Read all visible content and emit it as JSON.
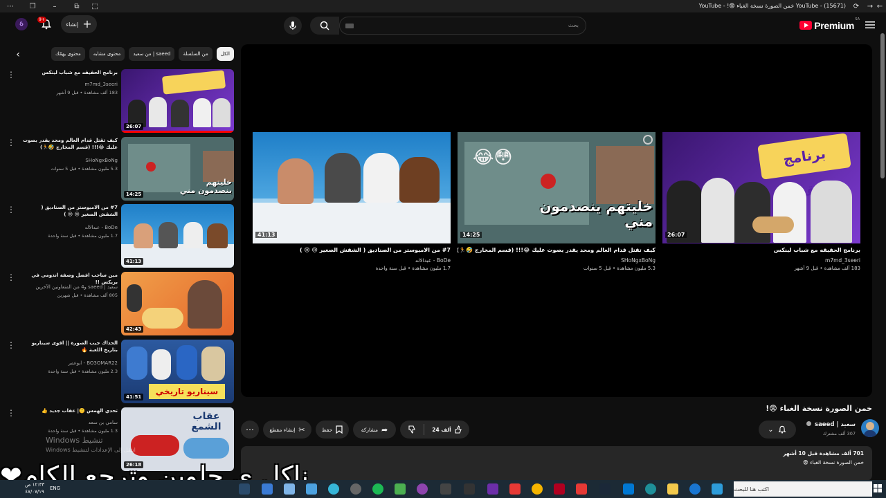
{
  "browser": {
    "window_title": "YouTube - (15671) خمن الصورة نسخة الغباء 😨! - YouTube"
  },
  "header": {
    "search_placeholder": "بحث",
    "create_label": "إنشاء",
    "logo_word": "Premium",
    "logo_region": "SA",
    "notification_count": "9+"
  },
  "chips": [
    "الكل",
    "من السلسلة",
    "من سعيد | saeed",
    "محتوى مشابه",
    "محتوى يهمّك"
  ],
  "recommendations": [
    {
      "title": "برنامج الحقيقه مع شباب لينكس",
      "channel": "m7md_3seeri",
      "meta": "183 ألف مشاهدة • قبل 9 أشهر",
      "duration": "26:07"
    },
    {
      "title": "كيف تقتل قدام العالم ومحد يقدر يصوت عليك 😂!!! (قسم المخارج 🤣🏃)",
      "channel": "SHoNgxBoNg",
      "meta": "5.3 مليون مشاهدة • قبل 5 سنوات",
      "duration": "14:25"
    },
    {
      "title": "#7 من الاميوستر من الصناديق ( الشقش الصغير 😢 😢 )",
      "channel": "BoDe - عبدالاله",
      "meta": "1.7 مليون مشاهدة • قبل سنة واحدة",
      "duration": "41:13"
    },
    {
      "title": "مين ساحب افضل وصفة اندومي في بريكس !!",
      "channel": "سعيد | saeed و4 من المتعاونين الآخرين",
      "meta": "805 آلف مشاهدة • قبل شهرين",
      "duration": "42:43"
    },
    {
      "title": "الحداك جيب الصورة || اقوى سيناريو بتاريخ اللعبة 🔥",
      "channel": "BO3OMAR22 - ابوعمر",
      "meta": "2.3 مليون مشاهدة • قبل سنة واحدة",
      "duration": "41:51"
    },
    {
      "title": "تحدي الهمس 🤫| عقاب جديد 👍",
      "channel": "سامي بن سعد",
      "meta": "1.3 مليون مشاهدة • قبل سنة واحدة",
      "duration": "26:18"
    }
  ],
  "endcards": [
    {
      "title": "برنامج الحقيقه مع شباب لينكس",
      "channel": "m7md_3seeri",
      "meta": "183 ألف مشاهدة • قبل 9 أشهر",
      "duration": "26:07",
      "thumb_text": "برنامج الحقيقة"
    },
    {
      "title": "كيف تقتل قدام العالم ومحد يقدر يصوت عليك 😂!!! (قسم المخارج 🤣🏃)",
      "channel": "SHoNgxBoNg",
      "meta": "5.3 مليون مشاهدة • قبل 5 سنوات",
      "duration": "14:25",
      "thumb_text": "خليتهم ينصدمون مني"
    },
    {
      "title": "#7 من الاميوستر من الصناديق ( الشقش الصغير 😢 😢 )",
      "channel": "BoDe - عبدالاله",
      "meta": "1.7 مليون مشاهدة • قبل سنة واحدة",
      "duration": "41:13",
      "thumb_text": ""
    }
  ],
  "video": {
    "title": "خمن الصورة نسخة الغباء 😨!",
    "channel_name": "سعيد | saeed",
    "subscribers": "307 ألف مشترك",
    "likes": "24 ألف",
    "share_label": "مشاركة",
    "save_label": "حفظ",
    "clip_label": "إنشاء مقطع",
    "description_views": "701 ألف مشاهدة  قبل 10 أشهر",
    "description_line": "خمن الصورة نسخة الغباء 😨"
  },
  "overlay": {
    "caption": "ناكل ي حلوين وترجع الكام❤",
    "watermark_title": "تنشيط Windows",
    "watermark_sub": "انتقل إلى الإعدادات لتنشيط Windows"
  },
  "taskbar": {
    "search_placeholder": "اكتب هنا للبحث",
    "time": "١٢:٣٣ ص",
    "date": "٤٧/٠٧/١٩",
    "lang": "ENG"
  },
  "thumb_colors": {
    "purple": "#6a2fb5",
    "game": "#4e6a6a",
    "blue": "#2b8fd4",
    "orange": "#e7752a",
    "navy": "#2c5aa0",
    "sky": "#d8dde6"
  }
}
